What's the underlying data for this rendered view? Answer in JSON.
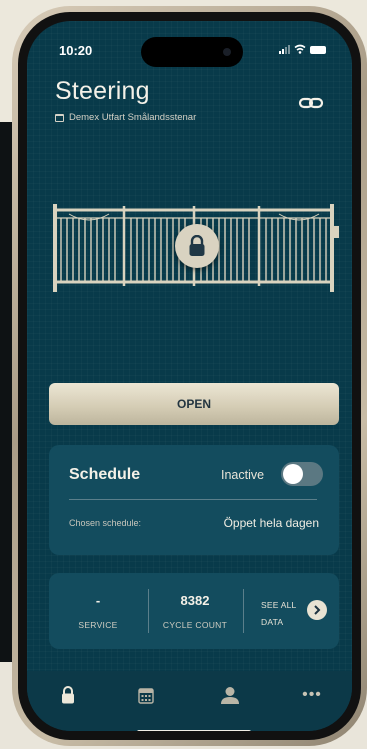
{
  "status_bar": {
    "time": "10:20"
  },
  "header": {
    "title": "Steering",
    "subtitle": "Demex Utfart Smålandsstenar"
  },
  "controls": {
    "open_label": "OPEN"
  },
  "schedule": {
    "title": "Schedule",
    "status": "Inactive",
    "enabled": false,
    "chosen_label": "Chosen schedule:",
    "chosen_value": "Öppet hela dagen"
  },
  "stats": {
    "service_value": "-",
    "service_label": "SERVICE",
    "cycle_value": "8382",
    "cycle_label": "CYCLE COUNT",
    "see_all_line1": "SEE ALL",
    "see_all_line2": "DATA"
  },
  "tabbar": {
    "items": [
      {
        "icon": "lock-icon",
        "active": true
      },
      {
        "icon": "calendar-icon",
        "active": false
      },
      {
        "icon": "user-icon",
        "active": false
      },
      {
        "icon": "more-icon",
        "active": false
      }
    ]
  },
  "colors": {
    "background": "#083a4a",
    "card": "#134c5e",
    "accent": "#e0d9c4",
    "text": "#f4f1e8"
  }
}
